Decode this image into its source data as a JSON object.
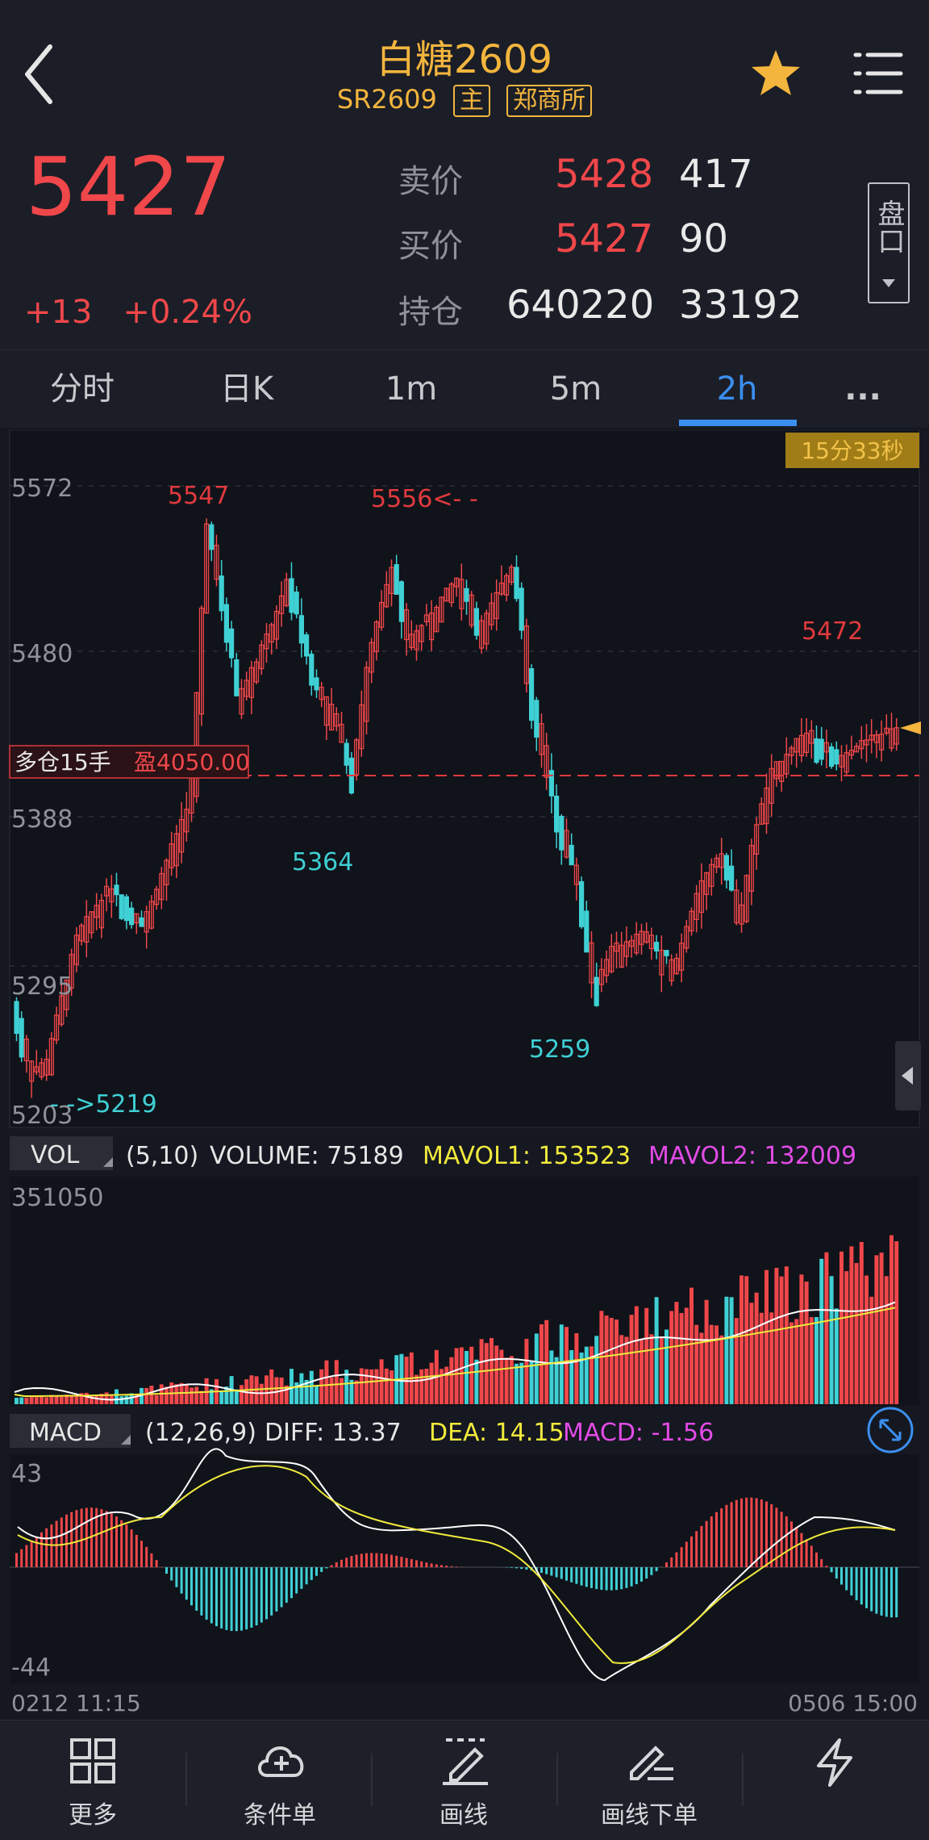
{
  "header": {
    "title": "白糖2609",
    "code": "SR2609",
    "tag_main": "主",
    "tag_exchange": "郑商所"
  },
  "quote": {
    "last": "5427",
    "change": "+13",
    "change_pct": "+0.24%",
    "ask_label": "卖价",
    "ask_price": "5428",
    "ask_vol": "417",
    "bid_label": "买价",
    "bid_price": "5427",
    "bid_vol": "90",
    "oi_label": "持仓",
    "oi_value": "640220",
    "oi_change": "33192",
    "pankou": "盘口"
  },
  "tabs": [
    "分时",
    "日K",
    "1m",
    "5m",
    "2h",
    "..."
  ],
  "active_tab": "2h",
  "chart": {
    "countdown": "15分33秒",
    "y_ticks": [
      "5572",
      "5480",
      "5388",
      "5295",
      "5203"
    ],
    "annotations": {
      "high1": "5547",
      "high2": "5556<- -",
      "low1": "5364",
      "low2": "5259",
      "start": "- ->5219",
      "last_high": "5472"
    },
    "position_label": "多仓15手",
    "position_profit": "盈4050.00",
    "vol_tag": "VOL",
    "vol_params": "(5,10)",
    "volume_text": "VOLUME: 75189",
    "mavol1_text": "MAVOL1: 153523",
    "mavol2_text": "MAVOL2: 132009",
    "vol_max": "351050",
    "macd_tag": "MACD",
    "macd_params": "(12,26,9)",
    "diff_text": "DIFF: 13.37",
    "dea_text": "DEA: 14.15",
    "macd_text": "MACD: -1.56",
    "macd_top": "43",
    "macd_bottom": "-44",
    "time_start": "0212 11:15",
    "time_end": "0506 15:00"
  },
  "colors": {
    "up": "#f0474a",
    "down": "#3fd0d4",
    "accent": "#f3b53d",
    "active": "#3b8ff0"
  },
  "bottom_nav": [
    {
      "label": "更多",
      "icon": "grid-icon"
    },
    {
      "label": "条件单",
      "icon": "cloud-plus-icon"
    },
    {
      "label": "画线",
      "icon": "pen-line-icon"
    },
    {
      "label": "画线下单",
      "icon": "pen-order-icon"
    },
    {
      "label": "",
      "icon": "lightning-icon"
    }
  ]
}
